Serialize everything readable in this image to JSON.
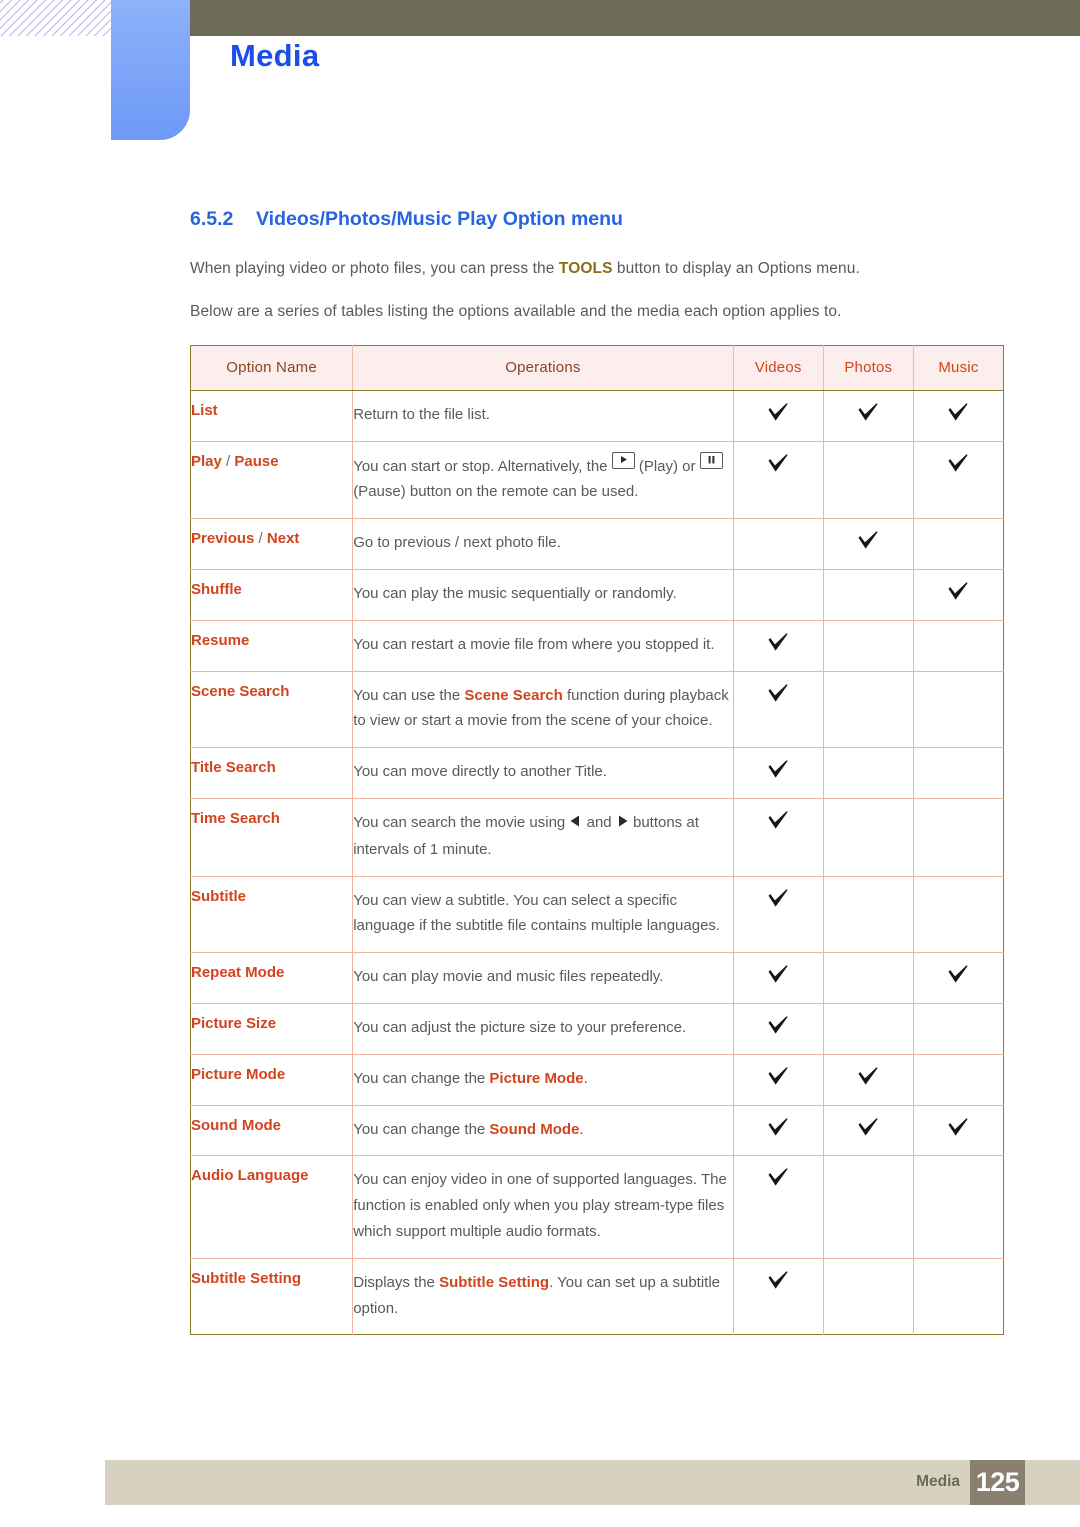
{
  "header": {
    "chapter_title": "Media",
    "accent_blue": "#1a4dea",
    "olive_bar_color": "#6d6b56",
    "tab_color": "#7fa6f8"
  },
  "section": {
    "number": "6.5.2",
    "title": "Videos/Photos/Music Play Option menu",
    "paragraph_1_before": "When playing video or photo files, you can press the ",
    "paragraph_1_keyword": "TOOLS",
    "paragraph_1_after": " button to display an Options menu.",
    "paragraph_2": "Below are a series of tables listing the options available and the media each option applies to."
  },
  "table": {
    "columns": [
      "Option Name",
      "Operations",
      "Videos",
      "Photos",
      "Music"
    ],
    "rows": [
      {
        "name": "List",
        "name_parts": [
          {
            "t": "List",
            "style": "key"
          }
        ],
        "ops_html": "Return to the file list.",
        "videos": true,
        "photos": true,
        "music": true
      },
      {
        "name": "Play / Pause",
        "name_parts": [
          {
            "t": "Play",
            "style": "key"
          },
          {
            "t": " / ",
            "style": "slash"
          },
          {
            "t": "Pause",
            "style": "key"
          }
        ],
        "ops_html": "You can start or stop. Alternatively, the [PLAY_KEY] (Play) or [PAUSE_KEY] (Pause) button on the remote can be used.",
        "videos": true,
        "photos": false,
        "music": true
      },
      {
        "name": "Previous / Next",
        "name_parts": [
          {
            "t": "Previous",
            "style": "key"
          },
          {
            "t": " / ",
            "style": "slash"
          },
          {
            "t": "Next",
            "style": "key"
          }
        ],
        "ops_html": "Go to previous / next photo file.",
        "videos": false,
        "photos": true,
        "music": false
      },
      {
        "name": "Shuffle",
        "name_parts": [
          {
            "t": "Shuffle",
            "style": "key"
          }
        ],
        "ops_html": "You can play the music sequentially or randomly.",
        "videos": false,
        "photos": false,
        "music": true
      },
      {
        "name": "Resume",
        "name_parts": [
          {
            "t": "Resume",
            "style": "key"
          }
        ],
        "ops_html": "You can restart a movie file from where you stopped it.",
        "videos": true,
        "photos": false,
        "music": false
      },
      {
        "name": "Scene Search",
        "name_parts": [
          {
            "t": "Scene Search",
            "style": "key"
          }
        ],
        "ops_html": "You can use the <b>Scene Search</b> function during playback to view or start a movie from the scene of your choice.",
        "videos": true,
        "photos": false,
        "music": false
      },
      {
        "name": "Title Search",
        "name_parts": [
          {
            "t": "Title Search",
            "style": "key"
          }
        ],
        "ops_html": "You can move directly to another Title.",
        "videos": true,
        "photos": false,
        "music": false
      },
      {
        "name": "Time Search",
        "name_parts": [
          {
            "t": "Time Search",
            "style": "key"
          }
        ],
        "ops_html": "You can search the movie using [LEFT_TRI] and [RIGHT_TRI] buttons at intervals of 1 minute.",
        "videos": true,
        "photos": false,
        "music": false
      },
      {
        "name": "Subtitle",
        "name_parts": [
          {
            "t": "Subtitle",
            "style": "key"
          }
        ],
        "ops_html": "You can view a subtitle. You can select a specific language if the subtitle file contains multiple languages.",
        "videos": true,
        "photos": false,
        "music": false
      },
      {
        "name": "Repeat Mode",
        "name_parts": [
          {
            "t": "Repeat Mode",
            "style": "key"
          }
        ],
        "ops_html": "You can play movie and music files repeatedly.",
        "videos": true,
        "photos": false,
        "music": true
      },
      {
        "name": "Picture Size",
        "name_parts": [
          {
            "t": "Picture Size",
            "style": "key"
          }
        ],
        "ops_html": "You can adjust the picture size to your preference.",
        "videos": true,
        "photos": false,
        "music": false
      },
      {
        "name": "Picture Mode",
        "name_parts": [
          {
            "t": "Picture Mode",
            "style": "key"
          }
        ],
        "ops_html": "You can change the <b>Picture Mode</b>.",
        "videos": true,
        "photos": true,
        "music": false
      },
      {
        "name": "Sound Mode",
        "name_parts": [
          {
            "t": "Sound Mode",
            "style": "key"
          }
        ],
        "ops_html": "You can change the <b>Sound Mode</b>.",
        "videos": true,
        "photos": true,
        "music": true
      },
      {
        "name": "Audio Language",
        "name_parts": [
          {
            "t": "Audio Language",
            "style": "key"
          }
        ],
        "ops_html": "You can enjoy video in one of supported languages. The function is enabled only when you play stream-type files which support multiple audio formats.",
        "videos": true,
        "photos": false,
        "music": false
      },
      {
        "name": "Subtitle Setting",
        "name_parts": [
          {
            "t": "Subtitle Setting",
            "style": "key"
          }
        ],
        "ops_html": "Displays the <b>Subtitle Setting</b>. You can set up a subtitle option.",
        "videos": true,
        "photos": false,
        "music": false
      }
    ]
  },
  "footer": {
    "label": "Media",
    "page_number": "125",
    "bar_color": "#d7d2c0",
    "page_box_color": "#8a8070"
  },
  "icons": {
    "play_key": "play-button-key-icon",
    "pause_key": "pause-button-key-icon",
    "left_triangle": "left-arrow-icon",
    "right_triangle": "right-arrow-icon",
    "checkmark": "checkmark-icon"
  }
}
